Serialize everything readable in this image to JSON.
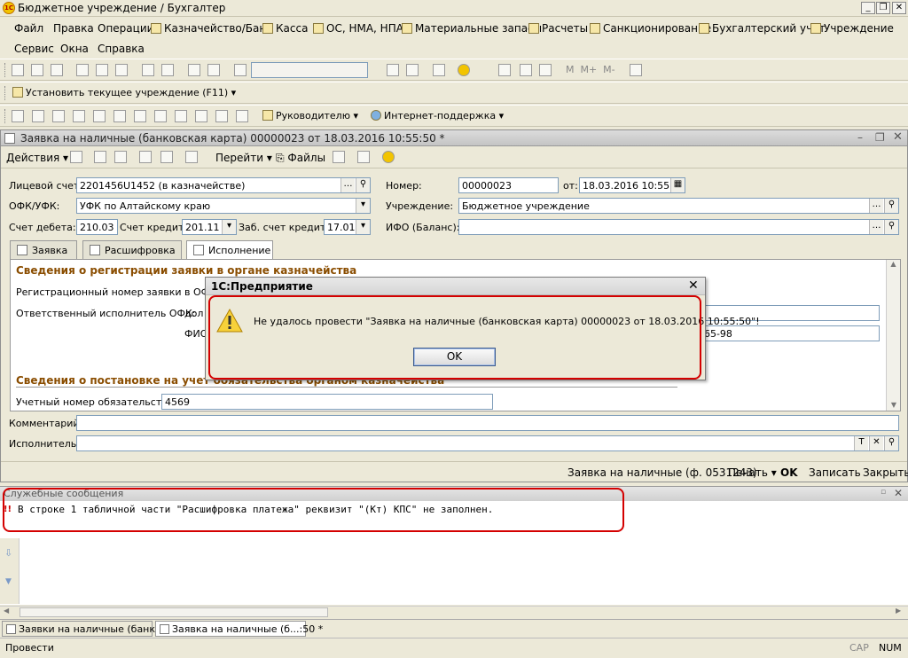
{
  "window_title": "Бюджетное учреждение / Бухгалтер",
  "menu_row1": [
    "Файл",
    "Правка",
    "Операции",
    "Казначейство/Банк",
    "Касса",
    "ОС, НМА, НПА",
    "Материальные запасы",
    "Расчеты",
    "Санкционирование",
    "Бухгалтерский учет",
    "Учреждение"
  ],
  "menu_row2": [
    "Сервис",
    "Окна",
    "Справка"
  ],
  "toolbar": {
    "set_institution": "Установить текущее учреждение (F11)",
    "managers": "Руководителю",
    "support": "Интернет-поддержка"
  },
  "doc": {
    "title": "Заявка на наличные (банковская карта) 00000023 от 18.03.2016 10:55:50 *",
    "actions": {
      "actions": "Действия",
      "goto": "Перейти",
      "files": "Файлы"
    },
    "fields": {
      "account_label": "Лицевой счет:",
      "account_value": "2201456U1452 (в казначействе)",
      "number_label": "Номер:",
      "number_value": "00000023",
      "from_label": "от:",
      "date_value": "18.03.2016 10:55:50",
      "ofk_label": "ОФК/УФК:",
      "ofk_value": "УФК по Алтайскому краю",
      "institution_label": "Учреждение:",
      "institution_value": "Бюджетное учреждение",
      "debit_label": "Счет дебета:",
      "debit_value": "210.03",
      "credit_label": "Счет кредита:",
      "credit_value": "201.11",
      "offbal_label": "Заб. счет кредита:",
      "offbal_value": "17.01",
      "ifo_label": "ИФО (Баланс):",
      "ifo_value": ""
    },
    "tabs": [
      "Заявка",
      "Расшифровка",
      "Исполнение"
    ],
    "panel": {
      "sec1": "Сведения о регистрации заявки в органе казначейства",
      "reg_label": "Регистрационный номер заявки в ОФК:",
      "resp_label": "Ответственный исполнитель ОФК:",
      "pos_label": "дол",
      "fio_label": "ФИО",
      "phone_tail": "45-65-98",
      "sec2": "Сведения о постановке на учет обязательства органом казначейства",
      "obl_label": "Учетный номер обязательства:",
      "obl_value": "4569"
    },
    "comment_label": "Комментарий:",
    "executor_label": "Исполнитель:",
    "status_buttons": {
      "form": "Заявка на наличные (ф. 0531243)",
      "print": "Печать",
      "ok": "OK",
      "save": "Записать",
      "close": "Закрыть"
    }
  },
  "dialog": {
    "title": "1С:Предприятие",
    "message": "Не удалось провести \"Заявка на наличные (банковская карта) 00000023 от 18.03.2016 10:55:50\"!",
    "ok": "OK"
  },
  "messages": {
    "title": "Служебные сообщения",
    "line": "В строке 1 табличной части \"Расшифровка платежа\" реквизит \"(Кт) КПС\" не заполнен."
  },
  "taskbar": [
    "Заявки на наличные (банко...",
    "Заявка на наличные (б...:50 *"
  ],
  "statusbar": {
    "left": "Провести",
    "cap": "CAP",
    "num": "NUM"
  }
}
